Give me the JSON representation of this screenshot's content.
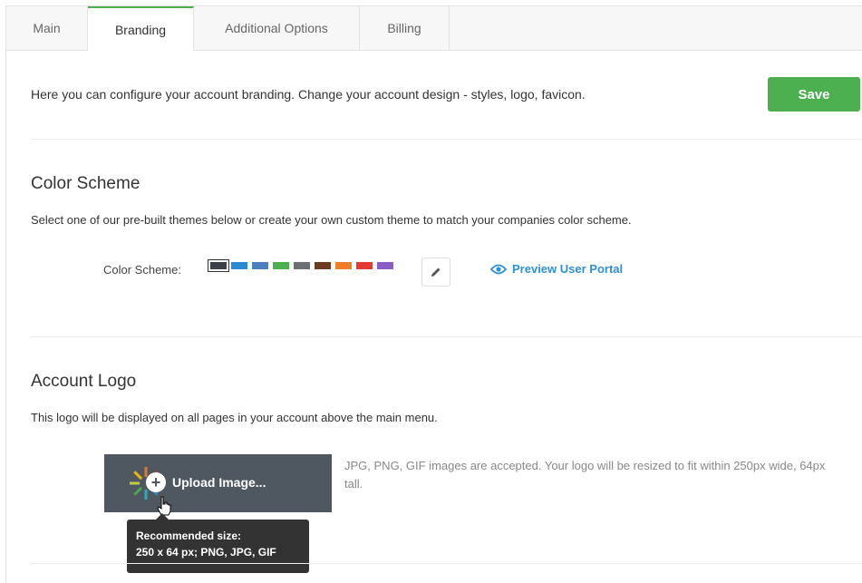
{
  "tabs": [
    {
      "label": "Main"
    },
    {
      "label": "Branding"
    },
    {
      "label": "Additional Options"
    },
    {
      "label": "Billing"
    }
  ],
  "intro_text": "Here you can configure your account branding. Change your account design - styles, logo, favicon.",
  "save_label": "Save",
  "color_scheme": {
    "heading": "Color Scheme",
    "description": "Select one of our pre-built themes below or create your own custom theme to match your companies color scheme.",
    "label": "Color Scheme:",
    "swatches": [
      "#3a4149",
      "#2b8cd6",
      "#4a80c0",
      "#4caf50",
      "#6c6f73",
      "#6b3a1f",
      "#f07e26",
      "#e53935",
      "#8a5cc4"
    ],
    "selected_index": 0,
    "preview_link": "Preview User Portal",
    "edit_icon": "pencil-icon",
    "preview_icon": "eye-icon"
  },
  "account_logo": {
    "heading": "Account Logo",
    "description": "This logo will be displayed on all pages in your account above the main menu.",
    "upload_label": "Upload Image...",
    "upload_note": "JPG, PNG, GIF images are accepted. Your logo will be resized to fit within 250px wide, 64px tall.",
    "tooltip_title": "Recommended size:",
    "tooltip_detail": "250 x 64 px; PNG, JPG, GIF"
  },
  "colors": {
    "accent": "#4caf50",
    "link": "#2d8fd5",
    "upload_bg": "#4f5860",
    "tooltip_bg": "#333333"
  }
}
